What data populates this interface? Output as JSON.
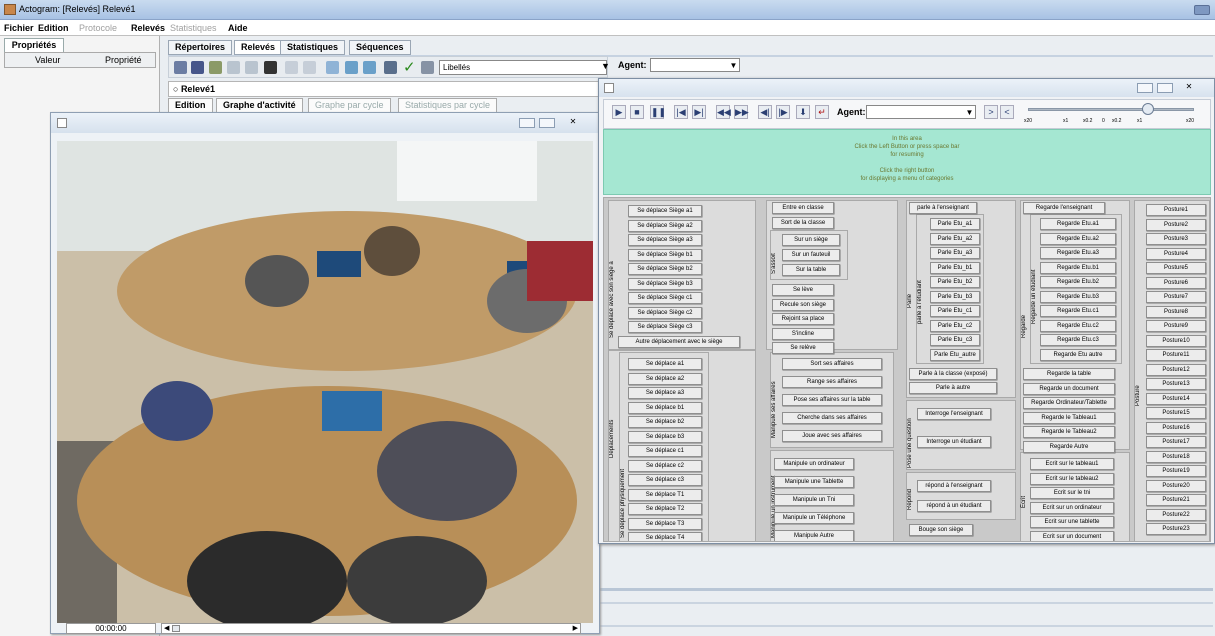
{
  "app": {
    "title": "Actogram: [Relevés] Relevé1"
  },
  "menu": [
    "Fichier",
    "Edition",
    "Protocole",
    "Relevés",
    "Statistiques",
    "Aide"
  ],
  "left_panel": {
    "tab": "Propriétés",
    "col1": "Valeur",
    "col2": "Propriété"
  },
  "main_tabs": [
    "Répertoires",
    "Relevés",
    "Statistiques",
    "Séquences"
  ],
  "toolbar": {
    "libelles": "Libellés",
    "agent_label": "Agent:"
  },
  "releve": "Relevé1",
  "sub_tabs": [
    "Edition",
    "Graphe d'activité",
    "Graphe par cycle",
    "Statistiques par cycle"
  ],
  "video": {
    "time": "00:00:00"
  },
  "cat": {
    "agent_label": "Agent:",
    "slider_ticks": [
      "x20",
      "x1",
      "x0.2",
      "0",
      "x0.2",
      "x1",
      "x20"
    ],
    "green_lines": [
      "In this area",
      "Click the Left Button or press space bar",
      "for resuming",
      "",
      "Click the right button",
      "for displaying a menu of categories"
    ]
  },
  "col1": {
    "label_top": "Se déplace avec son siège à",
    "top": [
      "Se déplace Siège a1",
      "Se déplace Siège a2",
      "Se déplace Siège a3",
      "Se déplace Siège b1",
      "Se déplace Siège b2",
      "Se déplace Siège b3",
      "Se déplace Siège c1",
      "Se déplace Siège c2",
      "Se déplace Siège c3",
      "Autre déplacement avec le siège"
    ],
    "label_outer": "Déplacements",
    "label_mid": "Se déplace physiquement",
    "mid": [
      "Se déplace a1",
      "Se déplace a2",
      "Se déplace a3",
      "Se déplace b1",
      "Se déplace b2",
      "Se déplace b3",
      "Se déplace c1",
      "Se déplace c2",
      "Se déplace c3",
      "Se déplace T1",
      "Se déplace T2",
      "Se déplace T3",
      "Se déplace T4"
    ]
  },
  "col2": {
    "top": [
      "Entre en classe",
      "Sort de la classe"
    ],
    "label_sit": "S'assoit",
    "sit": [
      "Sur un siège",
      "Sur un fauteuil",
      "Sur la table"
    ],
    "rest": [
      "Se lève",
      "Recule son siège",
      "Rejoint sa place",
      "S'incline",
      "Se relève"
    ],
    "label_aff": "Manipule ses affaires",
    "aff": [
      "Sort ses affaires",
      "Range ses affaires",
      "Pose ses affaires sur la table",
      "Cherche dans ses affaires",
      "Joue avec ses affaires"
    ],
    "label_inst": "Manipule un instrument",
    "inst": [
      "Manipule un ordinateur",
      "Manipule une Tablette",
      "Manipule un Tni",
      "Manipule un Téléphone",
      "Manipule Autre"
    ]
  },
  "col3": {
    "first": "parle à l'enseignant",
    "label_parle": "Parle",
    "label_etud": "parle à l'étudiant",
    "etud": [
      "Parle Etu_a1",
      "Parle Etu_a2",
      "Parle Etu_a3",
      "Parle Etu_b1",
      "Parle Etu_b2",
      "Parle Etu_b3",
      "Parle Etu_c1",
      "Parle Etu_c2",
      "Parle Etu_c3",
      "Parle Etu_autre"
    ],
    "after": [
      "Parle à la classe (exposé)",
      "Parle à autre"
    ],
    "label_q": "Pose une question",
    "q": [
      "Interroge l'enseignant",
      "Interroge un étudiant"
    ],
    "label_rep": "Répond",
    "rep": [
      "répond à l'enseignant",
      "répond à un étudiant"
    ],
    "last": "Bouge son siège"
  },
  "col4": {
    "first": "Regarde l'enseignant",
    "label_reg": "Regarde",
    "label_etud": "Regarde un étudiant",
    "etud": [
      "Regarde Etu.a1",
      "Regarde Etu.a2",
      "Regarde Etu.a3",
      "Regarde Etu.b1",
      "Regarde Etu.b2",
      "Regarde Etu.b3",
      "Regarde Etu.c1",
      "Regarde Etu.c2",
      "Regarde Etu.c3",
      "Regarde Etu autre"
    ],
    "after": [
      "Regarde la table",
      "Regarde un document",
      "Regarde Ordinateur/Tablette",
      "Regarde le Tableau1",
      "Regarde le Tableau2",
      "Regarde Autre"
    ],
    "label_ecr": "Écrit",
    "ecr": [
      "Ecrit sur le tableau1",
      "Ecrit sur le tableau2",
      "Ecrit sur le tni",
      "Ecrit sur un ordinateur",
      "Ecrit sur une tablette",
      "Ecrit sur un document"
    ]
  },
  "col5": {
    "label": "Posture",
    "items": [
      "Posture1",
      "Posture2",
      "Posture3",
      "Posture4",
      "Posture5",
      "Posture6",
      "Posture7",
      "Posture8",
      "Posture9",
      "Posture10",
      "Posture11",
      "Posture12",
      "Posture13",
      "Posture14",
      "Posture15",
      "Posture16",
      "Posture17",
      "Posture18",
      "Posture19",
      "Posture20",
      "Posture21",
      "Posture22",
      "Posture23"
    ]
  }
}
